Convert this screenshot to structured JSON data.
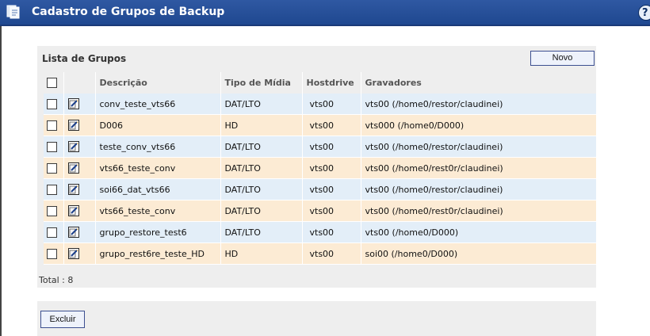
{
  "header": {
    "title": "Cadastro de Grupos de Backup",
    "help_glyph": "?"
  },
  "list": {
    "title": "Lista de Grupos",
    "new_button": "Novo",
    "columns": {
      "description": "Descrição",
      "media_type": "Tipo de Mídia",
      "hostdrive": "Hostdrive",
      "recorders": "Gravadores"
    },
    "rows": [
      {
        "description": "conv_teste_vts66",
        "media_type": "DAT/LTO",
        "hostdrive": "vts00",
        "recorders": "vts00 (/home0/restor/claudinei)"
      },
      {
        "description": "D006",
        "media_type": "HD",
        "hostdrive": "vts00",
        "recorders": "vts000 (/home0/D000)"
      },
      {
        "description": "teste_conv_vts66",
        "media_type": "DAT/LTO",
        "hostdrive": "vts00",
        "recorders": "vts00 (/home0/restor/claudinei)"
      },
      {
        "description": "vts66_teste_conv",
        "media_type": "DAT/LTO",
        "hostdrive": "vts00",
        "recorders": "vts00 (/home0/rest0r/claudinei)"
      },
      {
        "description": "soi66_dat_vts66",
        "media_type": "DAT/LTO",
        "hostdrive": "vts00",
        "recorders": "vts00 (/home0/restor/claudinei)"
      },
      {
        "description": "vts66_teste_conv",
        "media_type": "DAT/LTO",
        "hostdrive": "vts00",
        "recorders": "vts00 (/home0/rest0r/claudinei)"
      },
      {
        "description": "grupo_restore_test6",
        "media_type": "DAT/LTO",
        "hostdrive": "vts00",
        "recorders": "vts00 (/home0/D000)"
      },
      {
        "description": "grupo_rest6re_teste_HD",
        "media_type": "HD",
        "hostdrive": "vts00",
        "recorders": "soi00 (/home0/D000)"
      }
    ],
    "total": "Total : 8"
  },
  "footer": {
    "delete_button": "Excluir"
  },
  "colors": {
    "titlebar": "#2f58a2",
    "row_blue": "#e3eef8",
    "row_peach": "#fcebd4",
    "panel": "#eeeeee"
  },
  "icons": {
    "header": "document-icon",
    "row_action": "edit-icon",
    "help": "help-icon"
  }
}
